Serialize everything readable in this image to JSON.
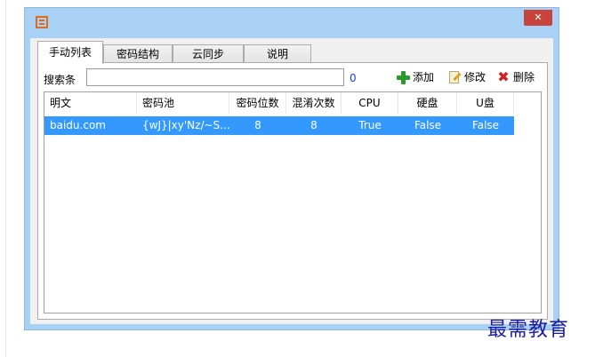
{
  "window": {
    "close_glyph": "✕"
  },
  "tabs": [
    {
      "label": "手动列表",
      "active": true
    },
    {
      "label": "密码结构",
      "active": false
    },
    {
      "label": "云同步",
      "active": false
    },
    {
      "label": "说明",
      "active": false
    }
  ],
  "search": {
    "label": "搜索条",
    "value": "",
    "count": "0"
  },
  "toolbar": {
    "add_label": "添加",
    "edit_label": "修改",
    "delete_label": "删除"
  },
  "table": {
    "columns": [
      "明文",
      "密码池",
      "密码位数",
      "混淆次数",
      "CPU",
      "硬盘",
      "U盘"
    ],
    "rows": [
      {
        "plaintext": "baidu.com",
        "pool": "{wJ}|xy'Nz/~S...",
        "length": "8",
        "rounds": "8",
        "cpu": "True",
        "disk": "False",
        "usb": "False",
        "selected": true
      }
    ]
  },
  "colors": {
    "selection": "#3399ff",
    "window_frame": "#a9d0f5",
    "close": "#c7433b",
    "count_text": "#1c3fd4"
  },
  "icons": {
    "app": "app-logo-icon",
    "add": "plus-icon",
    "edit": "edit-icon",
    "delete": "delete-icon"
  },
  "watermark": "最需教育"
}
